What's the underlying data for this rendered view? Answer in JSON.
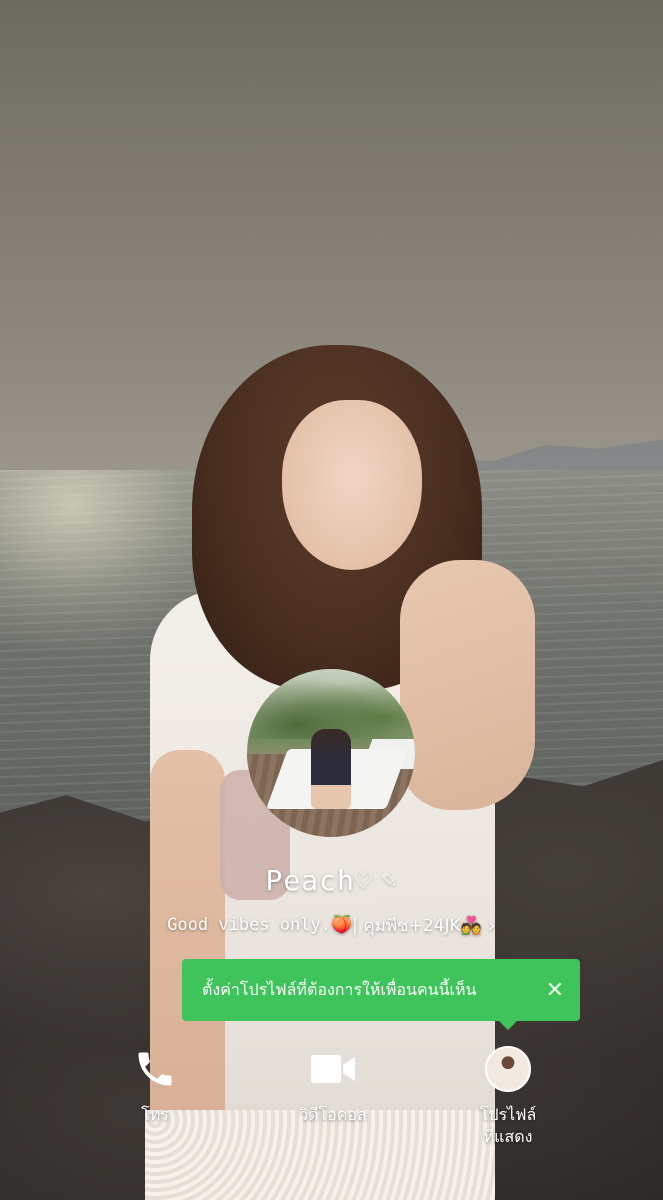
{
  "profile": {
    "name": "Peach♡",
    "status_prefix": "Good vibes only.",
    "status_emoji": "🍑",
    "status_suffix": " | คุมพีช+24JK💑"
  },
  "tooltip": {
    "text": "ตั้งค่าโปรไฟล์ที่ต้องการให้เพื่อนคนนี้เห็น"
  },
  "actions": {
    "call_label": "โทร",
    "video_label": "วิดีโอคอล",
    "profile_label_line1": "โปรไฟล์",
    "profile_label_line2": "ที่แสดง"
  },
  "colors": {
    "tooltip_bg": "#3ec45a",
    "text": "#ffffff"
  },
  "icons": {
    "edit": "pencil-icon",
    "more": "chevron-right-icon",
    "dismiss": "close-icon",
    "call": "phone-icon",
    "video": "video-camera-icon"
  }
}
